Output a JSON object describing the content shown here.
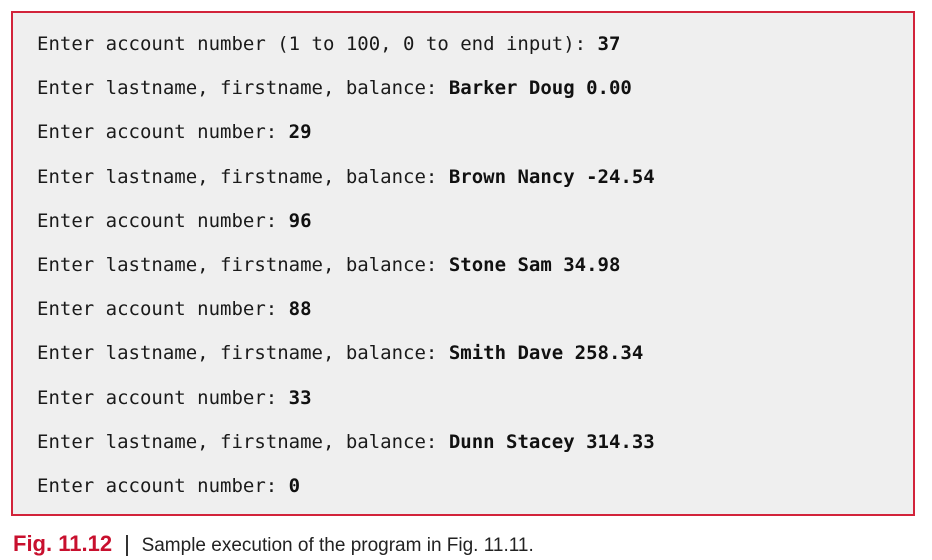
{
  "console": {
    "lines": [
      {
        "prompt": "Enter account number (1 to 100, 0 to end input): ",
        "input": "37"
      },
      {
        "prompt": "Enter lastname, firstname, balance: ",
        "input": "Barker Doug 0.00"
      },
      {
        "prompt": "Enter account number: ",
        "input": "29"
      },
      {
        "prompt": "Enter lastname, firstname, balance: ",
        "input": "Brown Nancy -24.54"
      },
      {
        "prompt": "Enter account number: ",
        "input": "96"
      },
      {
        "prompt": "Enter lastname, firstname, balance: ",
        "input": "Stone Sam 34.98"
      },
      {
        "prompt": "Enter account number: ",
        "input": "88"
      },
      {
        "prompt": "Enter lastname, firstname, balance: ",
        "input": "Smith Dave 258.34"
      },
      {
        "prompt": "Enter account number: ",
        "input": "33"
      },
      {
        "prompt": "Enter lastname, firstname, balance: ",
        "input": "Dunn Stacey 314.33"
      },
      {
        "prompt": "Enter account number: ",
        "input": "0"
      }
    ]
  },
  "caption": {
    "label": "Fig. 11.12",
    "text": "Sample execution of the program in Fig. 11.11."
  },
  "colors": {
    "border": "#d2233a",
    "panel_background": "#efefef",
    "figure_label": "#c8102e"
  }
}
